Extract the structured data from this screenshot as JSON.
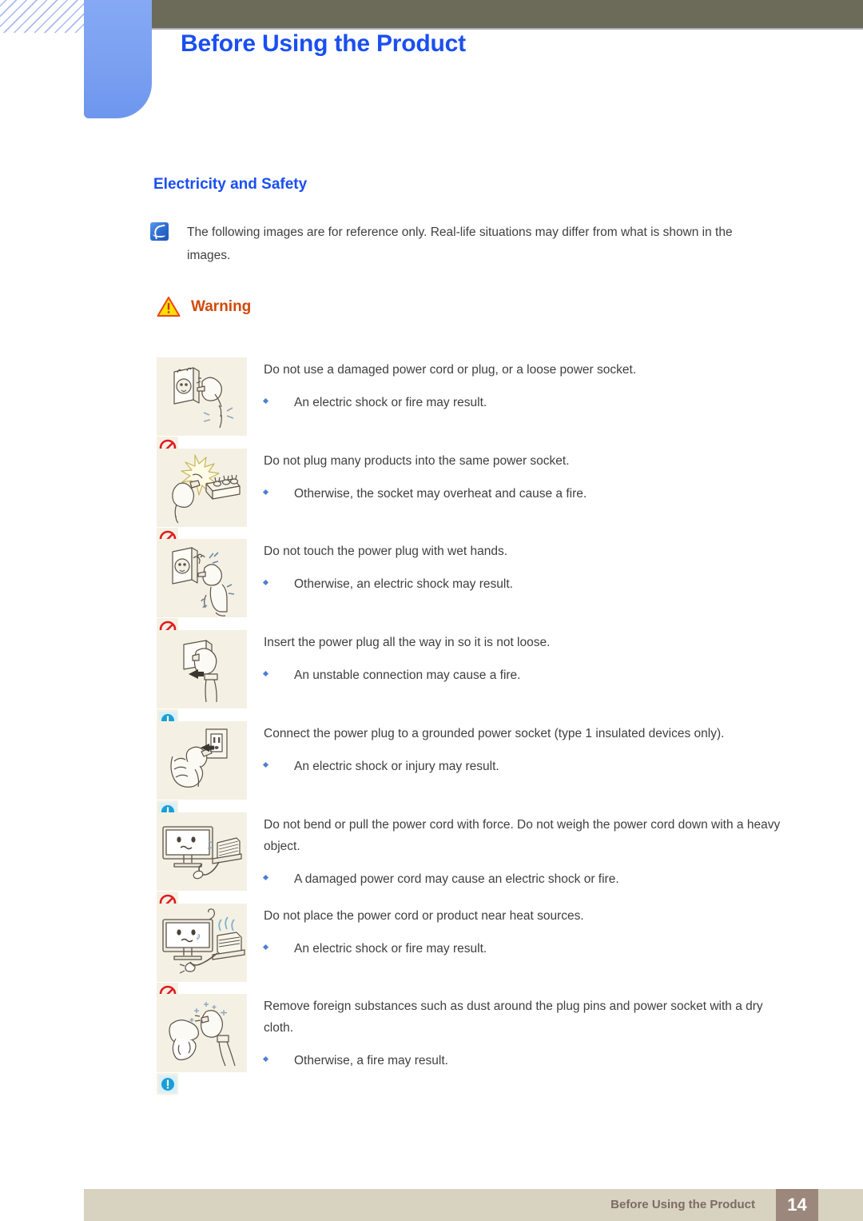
{
  "header": {
    "title": "Before Using the Product"
  },
  "section": {
    "title": "Electricity and Safety"
  },
  "note": {
    "icon": "note-icon",
    "text": "The following images are for reference only. Real-life situations may differ from what is shown in the images."
  },
  "warning": {
    "icon": "warning-triangle-icon",
    "label": "Warning"
  },
  "items": [
    {
      "figure": "damaged-power-cord-illustration",
      "badge": "prohibition-icon",
      "statement": "Do not use a damaged power cord or plug, or a loose power socket.",
      "bullet": "An electric shock or fire may result."
    },
    {
      "figure": "overloaded-power-strip-illustration",
      "badge": "prohibition-icon",
      "statement": "Do not plug many products into the same power socket.",
      "bullet": "Otherwise, the socket may overheat and cause a fire."
    },
    {
      "figure": "wet-hands-plug-illustration",
      "badge": "prohibition-icon",
      "statement": "Do not touch the power plug with wet hands.",
      "bullet": "Otherwise, an electric shock may result."
    },
    {
      "figure": "insert-plug-fully-illustration",
      "badge": "caution-icon",
      "statement": "Insert the power plug all the way in so it is not loose.",
      "bullet": "An unstable connection may cause a fire."
    },
    {
      "figure": "grounded-socket-illustration",
      "badge": "caution-icon",
      "statement": "Connect the power plug to a grounded power socket (type 1 insulated devices only).",
      "bullet": "An electric shock or injury may result."
    },
    {
      "figure": "bent-cord-heavy-object-illustration",
      "badge": "prohibition-icon",
      "statement": "Do not bend or pull the power cord with force. Do not weigh the power cord down with a heavy object.",
      "bullet": "A damaged power cord may cause an electric shock or fire."
    },
    {
      "figure": "cord-near-heat-source-illustration",
      "badge": "prohibition-icon",
      "statement": "Do not place the power cord or product near heat sources.",
      "bullet": "An electric shock or fire may result."
    },
    {
      "figure": "clean-plug-pins-illustration",
      "badge": "caution-icon",
      "statement": "Remove foreign substances such as dust around the plug pins and power socket with a dry cloth.",
      "bullet": "Otherwise, a fire may result."
    }
  ],
  "footer": {
    "text": "Before Using the Product",
    "page": "14"
  },
  "colors": {
    "title_blue": "#1a4ff0",
    "warning_orange": "#d14a0a",
    "topbar_olive": "#6c6a58",
    "footer_tan": "#d8d2c0",
    "footer_page_brown": "#9c877c",
    "figure_bg": "#f4f1e4",
    "bullet_blue": "#4a7fd4"
  }
}
